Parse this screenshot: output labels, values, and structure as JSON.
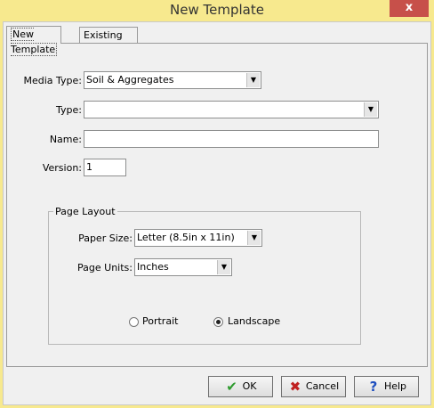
{
  "window": {
    "title": "New Template",
    "close_glyph": "x"
  },
  "tabs": [
    {
      "label": "New Template",
      "active": true
    },
    {
      "label": "Existing Templates",
      "active": false
    }
  ],
  "form": {
    "media_type": {
      "label": "Media Type:",
      "value": "Soil & Aggregates"
    },
    "type": {
      "label": "Type:",
      "value": ""
    },
    "name": {
      "label": "Name:",
      "value": ""
    },
    "version": {
      "label": "Version:",
      "value": "1"
    }
  },
  "page_layout": {
    "legend": "Page Layout",
    "paper_size": {
      "label": "Paper Size:",
      "value": "Letter (8.5in x 11in)"
    },
    "page_units": {
      "label": "Page Units:",
      "value": "Inches"
    },
    "orientation": {
      "portrait_label": "Portrait",
      "landscape_label": "Landscape",
      "selected": "Landscape"
    }
  },
  "buttons": {
    "ok": "OK",
    "cancel": "Cancel",
    "help": "Help"
  },
  "colors": {
    "titlebar": "#f7e98e",
    "close_button": "#c7504a",
    "ok_icon": "#2e9b2e",
    "cancel_icon": "#c02020",
    "help_icon": "#1f4fbf"
  },
  "icons": {
    "ok": "checkmark-icon",
    "cancel": "x-icon",
    "help": "question-mark-icon"
  }
}
